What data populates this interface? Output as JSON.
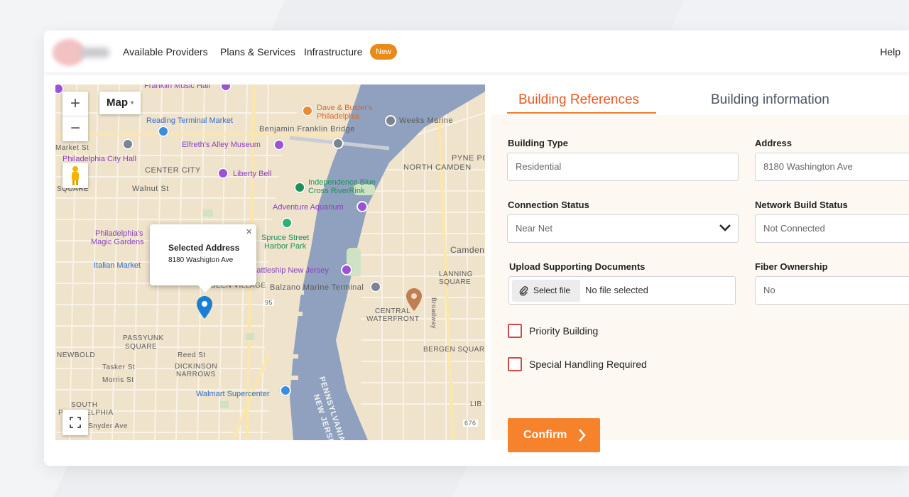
{
  "nav": {
    "links": [
      "Available Providers",
      "Plans & Services",
      "Infrastructure"
    ],
    "new_badge": "New",
    "help": "Help"
  },
  "map": {
    "map_type": "Map",
    "zoom_in": "+",
    "zoom_out": "−",
    "popup": {
      "title": "Selected Address",
      "address": "8180 Washigton Ave",
      "close": "×"
    },
    "labels": {
      "franklin_music_hall": "Franklin Music Hall",
      "reading_terminal": "Reading Terminal Market",
      "benjamin_franklin_bridge": "Benjamin Franklin Bridge",
      "dave_busters": "Dave & Buster's",
      "philadelphia": "Philadelphia",
      "weeks_marine": "Weeks Marine",
      "elfreths": "Elfreth's Alley Museum",
      "city_hall": "Philadelphia City Hall",
      "center_city": "CENTER CITY",
      "liberty_bell": "Liberty Bell",
      "pyne_po": "PYNE PO",
      "north_camden": "NORTH CAMDEN",
      "walnut_st": "Walnut St",
      "independence_blue": "Independence Blue",
      "cross_riverrink": "Cross RiverRink",
      "adventure_aquarium": "Adventure Aquarium",
      "magic_gardens_1": "Philadelphia's",
      "magic_gardens_2": "Magic Gardens",
      "spruce_street": "Spruce Street",
      "harbor_park": "Harbor Park",
      "camden": "Camden",
      "italian_market": "Italian Market",
      "battleship": "Battleship New Jersey",
      "balzano": "Balzano Marine Terminal",
      "lanning_square": "LANNING",
      "lanning_square2": "SQUARE",
      "queen_village": "QUEEN VILLAGE",
      "central_waterfront": "CENTRAL",
      "central_waterfront2": "WATERFRONT",
      "passyunk": "PASSYUNK",
      "passyunk2": "SQUARE",
      "newbold": "NEWBOLD",
      "reed_st": "Reed St",
      "dickinson": "DICKINSON",
      "dickinson2": "NARROWS",
      "bergen_square": "BERGEN SQUARE",
      "tasker_st": "Tasker St",
      "morris_st": "Morris St",
      "walmart": "Walmart Supercenter",
      "south_phila": "SOUTH",
      "south_phila2": "PHILADELPHIA",
      "snyder_ave": "Snyder Ave",
      "new_jersey": "NEW JERSEY",
      "pennsylvania": "PENNSYLVANIA",
      "square_left": "SQUARE",
      "market_st": "Market St",
      "broadway": "Broadway",
      "route_95": "95",
      "route_676": "676",
      "lib": "LIB"
    }
  },
  "form": {
    "tabs": [
      "Building References",
      "Building information"
    ],
    "building_type": {
      "label": "Building Type",
      "value": "Residential"
    },
    "address": {
      "label": "Address",
      "value": "8180 Washington Ave"
    },
    "connection_status": {
      "label": "Connection Status",
      "value": "Near Net"
    },
    "network_build_status": {
      "label": "Network Build Status",
      "value": "Not Connected"
    },
    "upload": {
      "label": "Upload Supporting Documents",
      "button": "Select file",
      "status": "No file selected"
    },
    "fiber_ownership": {
      "label": "Fiber Ownership",
      "value": "No"
    },
    "priority_building": "Priority Building",
    "special_handling": "Special Handling Required",
    "confirm": "Confirm"
  },
  "colors": {
    "accent": "#f6822c",
    "tab_active": "#e8591f",
    "checkbox_border": "#d04b43",
    "badge": "#e98a1b",
    "river": "#8fa1bf",
    "land": "#efe3cc"
  }
}
